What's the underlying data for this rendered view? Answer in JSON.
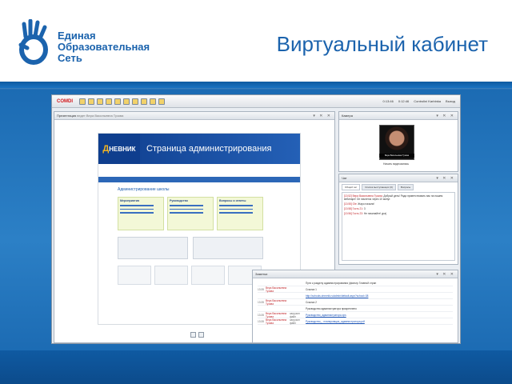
{
  "slide": {
    "brand_lines": [
      "Единая",
      "Образовательная",
      "Сеть"
    ],
    "title": "Виртуальный кабинет"
  },
  "app": {
    "logo": "COMDI",
    "toolbar_right": [
      "0:13:46",
      "0:12:46",
      "Сontrolini Karbinka",
      "Выход"
    ],
    "presentation": {
      "header": "Презентация",
      "header_sub": "ведет Вера Васильевна Тузова",
      "banner_logo": "НЕВНИК",
      "banner_logo_d": "Д",
      "banner_title": "Страница администрирования",
      "page_heading": "Администрирование школы",
      "cards": [
        "Мероприятия",
        "Руководство",
        "Вопросы и ответы"
      ]
    },
    "camera": {
      "header": "Камера",
      "name_tag": "Вера Васильевна Тузова",
      "control": "Начать видеозапись"
    },
    "chat": {
      "header": "Чат",
      "tabs": [
        "Общий чат",
        "Список выступающих (0)",
        "Вопросы"
      ],
      "lines": [
        {
          "who": "[13:52] Вера Васильевна Тузова:",
          "text": "Добрый день! Рада приветствовать вас на нашем вебинаре! Он начнется через 10 минут."
        },
        {
          "who": "[13:55] Ole:",
          "text": "Жаро начали!"
        },
        {
          "who": "[13:58] Гость 21:",
          "text": "3"
        },
        {
          "who": "[13:56] Гость 23:",
          "text": "Не начинайте! ура)"
        }
      ]
    },
    "notes": {
      "header": "Заметки",
      "rows": [
        {
          "time": "",
          "who": "",
          "action": "",
          "text": "Пути к разделу администрирования (фильтр Главной стран"
        },
        {
          "time": "13:35",
          "who": "Вера Васильевна Тузова",
          "action": "",
          "text": "Ссылка 1"
        },
        {
          "time": "",
          "who": "",
          "action": "",
          "text": "http://schools.dnevnik.ru/admin/default.aspx?school=38",
          "link": true
        },
        {
          "time": "13:35",
          "who": "Вера Васильевна Тузова",
          "action": "",
          "text": "Ссылка 2"
        },
        {
          "time": "",
          "who": "",
          "action": "",
          "text": "Руководство администратора прикреплено"
        },
        {
          "time": "13:35",
          "who": "Вера Васильевна Тузова",
          "action": "загрузил файл",
          "text": "Руководство_администратора.xps",
          "link": true
        },
        {
          "time": "13:35",
          "who": "Вера Васильевна Тузова",
          "action": "загрузил файл",
          "text": "Руководство_- планировщик_администратора.pdf",
          "link": true
        }
      ]
    }
  }
}
